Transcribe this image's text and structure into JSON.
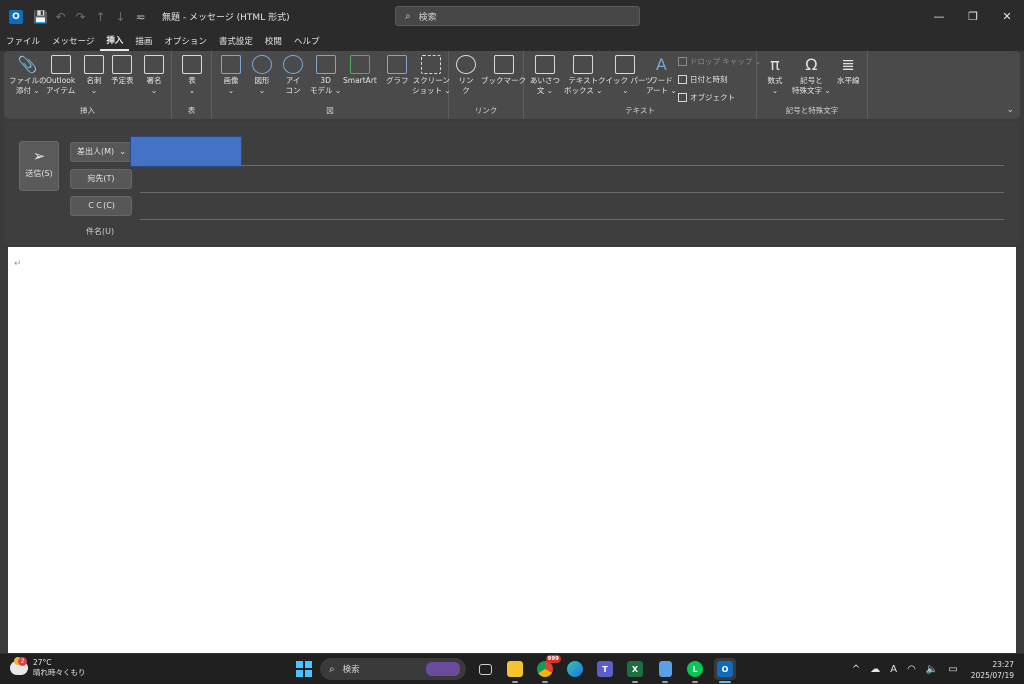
{
  "window": {
    "app_icon_letter": "O",
    "title": "無題  -  メッセージ (HTML 形式)",
    "search_label": "検索",
    "controls": [
      "—",
      "❐",
      "✕"
    ]
  },
  "qat": {
    "save": "💾",
    "undo": "↶",
    "redo": "↷",
    "up": "↑",
    "down": "↓",
    "customize": "≂"
  },
  "menu": {
    "tabs": [
      "ファイル",
      "メッセージ",
      "挿入",
      "描画",
      "オプション",
      "書式設定",
      "校閲",
      "ヘルプ"
    ],
    "active_index": 2
  },
  "ribbon": {
    "groups": {
      "insert": {
        "label": "挿入",
        "attach_file": [
          "ファイルの",
          "添付 ⌄"
        ],
        "outlook_item": [
          "Outlook",
          "アイテム"
        ],
        "business_card": [
          "名刺",
          "⌄"
        ],
        "calendar": [
          "予定表"
        ],
        "signature": [
          "署名",
          "⌄"
        ]
      },
      "table": {
        "label": "表",
        "table": [
          "表",
          "⌄"
        ]
      },
      "illustrations": {
        "label": "図",
        "pictures": [
          "画像",
          "⌄"
        ],
        "shapes": [
          "図形",
          "⌄"
        ],
        "icons": [
          "アイ",
          "コン"
        ],
        "models3d": [
          "3D",
          "モデル ⌄"
        ],
        "smartart": [
          "SmartArt"
        ],
        "chart": [
          "グラフ"
        ],
        "screenshot": [
          "スクリーン",
          "ショット ⌄"
        ]
      },
      "links": {
        "label": "リンク",
        "link": [
          "リン",
          "ク"
        ],
        "bookmark": [
          "ブックマーク"
        ]
      },
      "text": {
        "label": "テキスト",
        "greeting": [
          "あいさつ",
          "文 ⌄"
        ],
        "textbox": [
          "テキスト",
          "ボックス ⌄"
        ],
        "quick_parts": [
          "クイック パーツ",
          "⌄"
        ],
        "wordart": [
          "ワード",
          "アート ⌄"
        ],
        "drop_cap": "ドロップ キャップ ⌄",
        "date_time": "日付と時刻",
        "object": "オブジェクト"
      },
      "symbols": {
        "label": "記号と特殊文字",
        "equation": [
          "数式",
          "⌄"
        ],
        "symbol": [
          "記号と",
          "特殊文字 ⌄"
        ],
        "horizontal_line": [
          "水平線"
        ]
      }
    },
    "collapse": "⌄"
  },
  "compose": {
    "send_label": "送信(S)",
    "from_label": "差出人(M)",
    "from_chevron": "⌄",
    "to_label": "宛先(T)",
    "cc_label": "ＣＣ(C)",
    "subject_label": "件名(U)",
    "body_mark": "↵",
    "from_value_color": "#4472c4"
  },
  "taskbar": {
    "weather_badge": "2",
    "temperature": "27°C",
    "weather_desc": "晴れ時々くもり",
    "search_label": "検索",
    "chrome_badge": "999",
    "apps": [
      "task-view",
      "file-explorer",
      "chrome",
      "edge",
      "teams",
      "excel",
      "notepad",
      "line",
      "outlook"
    ],
    "clock_time": "23:27",
    "clock_date": "2025/07/19",
    "tray_icons": [
      "^",
      "☁",
      "A",
      "◠",
      "🔈",
      "▭"
    ]
  }
}
